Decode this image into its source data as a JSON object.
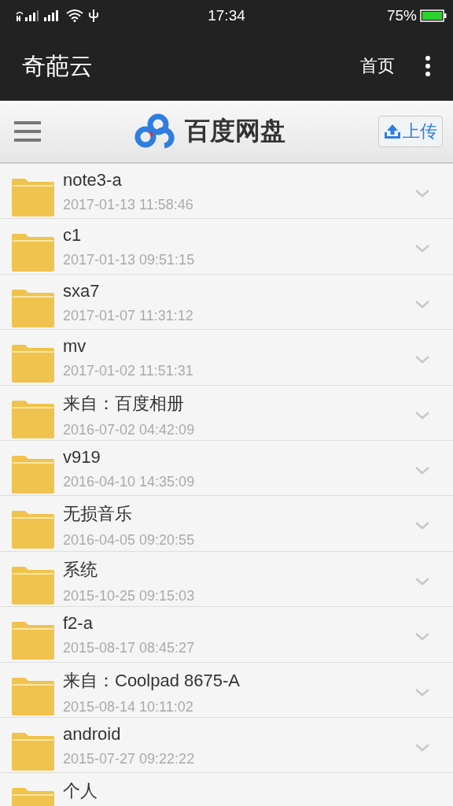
{
  "status_bar": {
    "time": "17:34",
    "battery": "75%"
  },
  "app_bar": {
    "title": "奇葩云",
    "home": "首页"
  },
  "header": {
    "logo_text": "百度网盘",
    "upload": "上传"
  },
  "files": [
    {
      "name": "note3-a",
      "date": "2017-01-13 11:58:46"
    },
    {
      "name": "c1",
      "date": "2017-01-13 09:51:15"
    },
    {
      "name": "sxa7",
      "date": "2017-01-07 11:31:12"
    },
    {
      "name": "mv",
      "date": "2017-01-02 11:51:31"
    },
    {
      "name": "来自：百度相册",
      "date": "2016-07-02 04:42:09"
    },
    {
      "name": "v919",
      "date": "2016-04-10 14:35:09"
    },
    {
      "name": "无损音乐",
      "date": "2016-04-05 09:20:55"
    },
    {
      "name": "系统",
      "date": "2015-10-25 09:15:03"
    },
    {
      "name": "f2-a",
      "date": "2015-08-17 08:45:27"
    },
    {
      "name": "来自：Coolpad 8675-A",
      "date": "2015-08-14 10:11:02"
    },
    {
      "name": "android",
      "date": "2015-07-27 09:22:22"
    },
    {
      "name": "个人"
    }
  ]
}
